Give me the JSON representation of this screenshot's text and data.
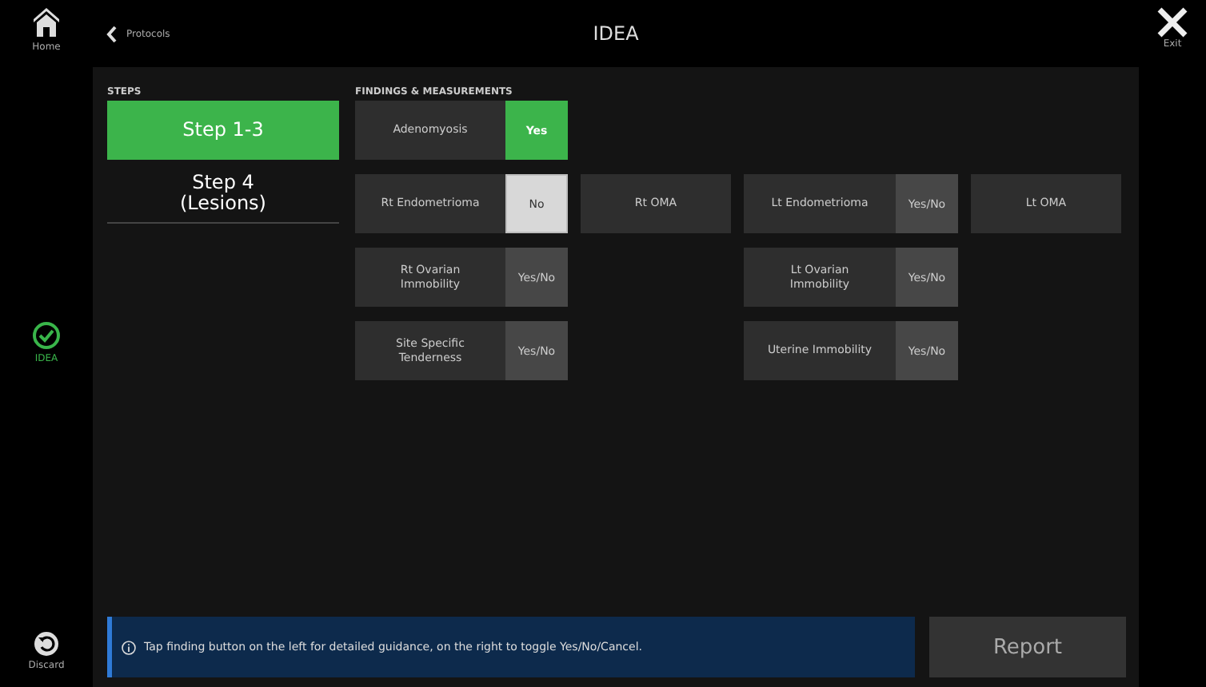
{
  "rail": {
    "items": [
      {
        "kind": "home",
        "label": "Home",
        "selected": false
      },
      {
        "kind": "check",
        "label": "IDEA",
        "selected": true
      },
      {
        "kind": "discard",
        "label": "Discard",
        "selected": false
      }
    ]
  },
  "top_bar": {
    "back_label": "Protocols",
    "title": "IDEA",
    "exit_label": "Exit"
  },
  "steps": {
    "header": "STEPS",
    "items": [
      {
        "label": "Step 1-3",
        "selected": true
      },
      {
        "label": "Step 4\n(Lesions)",
        "selected": false
      }
    ]
  },
  "findings": {
    "header": "FINDINGS & MEASUREMENTS",
    "rows": [
      {
        "cells": [
          {
            "kind": "toggle",
            "label": "Adenomyosis",
            "value": "Yes",
            "yes": true,
            "no": false
          },
          null,
          null,
          null
        ]
      },
      {
        "cells": [
          {
            "kind": "toggle",
            "label": "Rt Endometrioma",
            "value": "No",
            "yes": false,
            "no": true
          },
          {
            "kind": "plain",
            "label": "Rt OMA"
          },
          {
            "kind": "toggle",
            "label": "Lt Endometrioma",
            "value": "Yes/No",
            "yes": false,
            "no": false
          },
          {
            "kind": "plain",
            "label": "Lt OMA"
          }
        ]
      },
      {
        "cells": [
          {
            "kind": "toggle",
            "label": "Rt Ovarian\nImmobility",
            "value": "Yes/No",
            "yes": false,
            "no": false
          },
          null,
          {
            "kind": "toggle",
            "label": "Lt Ovarian\nImmobility",
            "value": "Yes/No",
            "yes": false,
            "no": false
          },
          null
        ]
      },
      {
        "cells": [
          {
            "kind": "toggle",
            "label": "Site Specific\nTenderness",
            "value": "Yes/No",
            "yes": false,
            "no": false
          },
          null,
          {
            "kind": "toggle",
            "label": "Uterine Immobility",
            "value": "Yes/No",
            "yes": false,
            "no": false
          },
          null
        ]
      }
    ]
  },
  "info": {
    "text": "Tap finding button on the left for detailed guidance, on the right to toggle Yes/No/Cancel."
  },
  "report_button": "Report"
}
